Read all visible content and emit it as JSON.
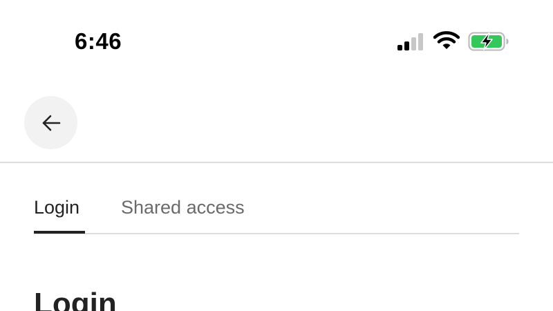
{
  "status_bar": {
    "time": "6:46",
    "signal_icon": "cellular-signal-icon",
    "wifi_icon": "wifi-icon",
    "battery_icon": "battery-charging-icon",
    "battery_color": "#34c759"
  },
  "header": {
    "back_icon": "arrow-left-icon"
  },
  "tabs": [
    {
      "label": "Login",
      "active": true
    },
    {
      "label": "Shared access",
      "active": false
    }
  ],
  "main": {
    "section_title": "Login"
  }
}
